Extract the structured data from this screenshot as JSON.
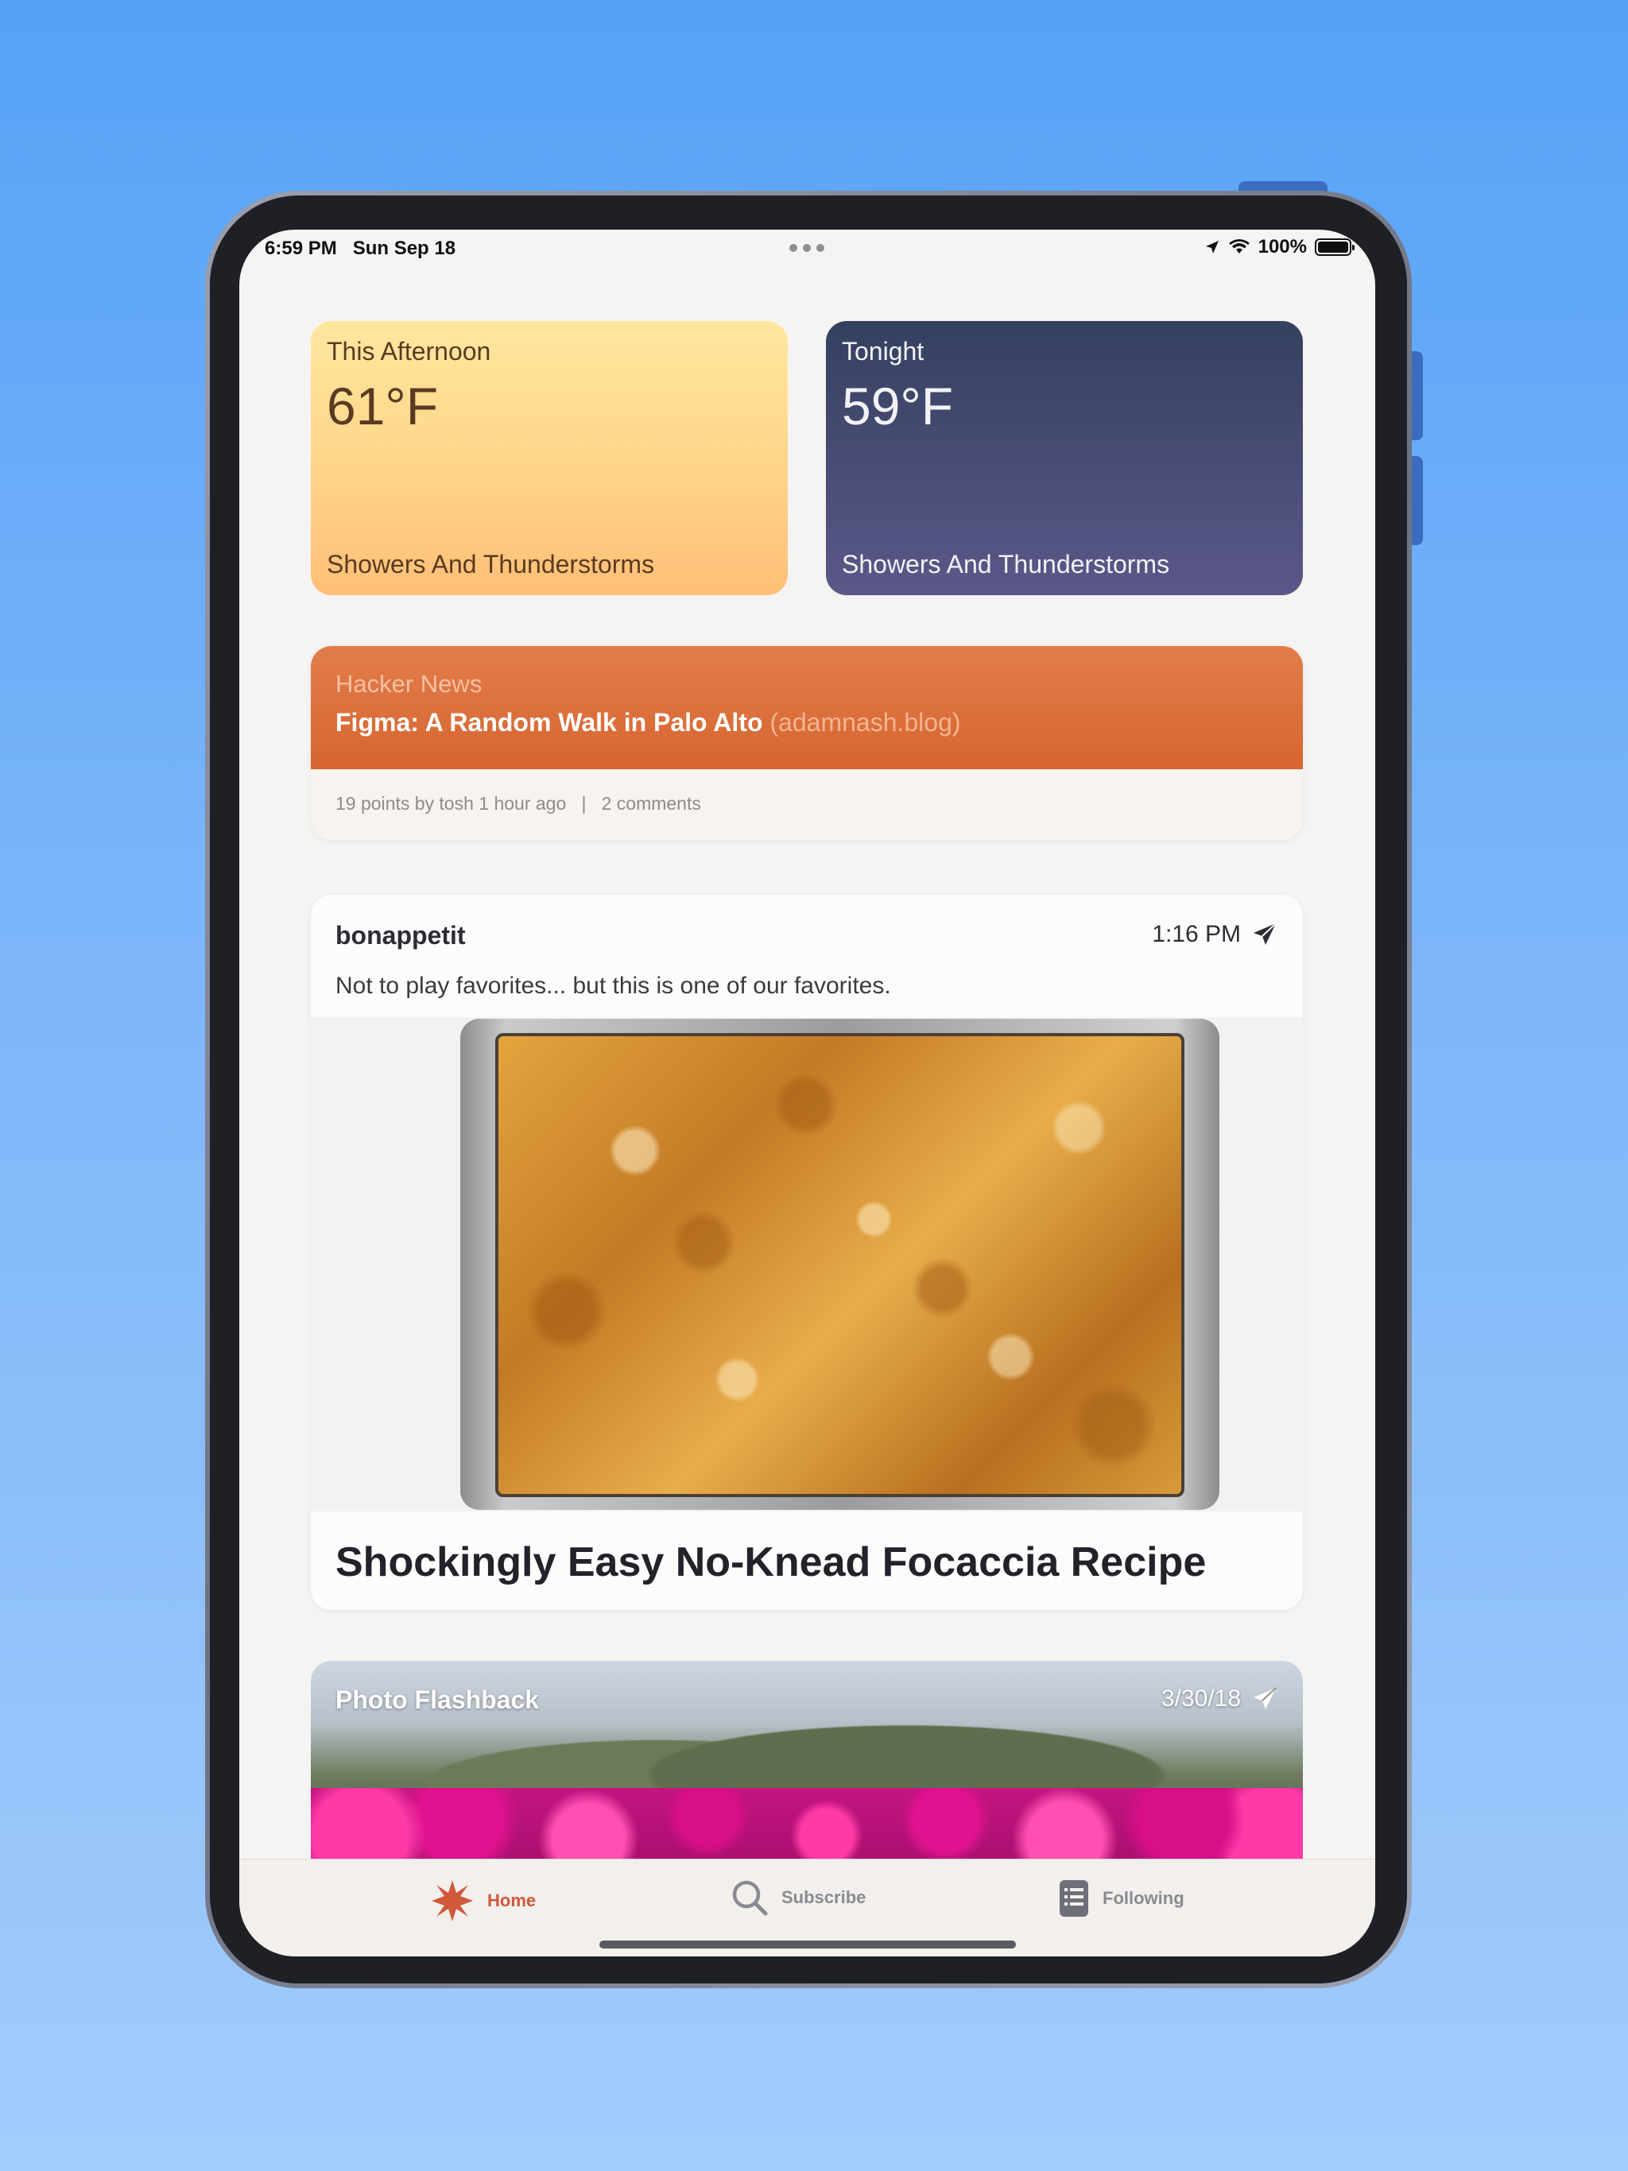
{
  "status_bar": {
    "time": "6:59 PM   Sun Sep 18",
    "battery": "100%"
  },
  "weather": {
    "afternoon": {
      "label": "This Afternoon",
      "temp": "61°F",
      "condition": "Showers And Thunderstorms"
    },
    "tonight": {
      "label": "Tonight",
      "temp": "59°F",
      "condition": "Showers And Thunderstorms"
    }
  },
  "hacker_news": {
    "source": "Hacker News",
    "title": "Figma: A Random Walk in Palo Alto",
    "domain": "(adamnash.blog)",
    "points_meta": "19 points by tosh 1 hour ago",
    "separator": "|",
    "comments": "2 comments"
  },
  "post": {
    "author": "bonappetit",
    "time": "1:16 PM",
    "text": "Not to play favorites... but this is one of our favorites.",
    "headline": "Shockingly Easy No-Knead Focaccia Recipe"
  },
  "flashback": {
    "title": "Photo Flashback",
    "date": "3/30/18"
  },
  "tabs": {
    "home": "Home",
    "subscribe": "Subscribe",
    "following": "Following"
  },
  "colors": {
    "accent": "#d1583a",
    "hn_orange": "#d7652f",
    "tab_inactive": "#8a8a92"
  }
}
